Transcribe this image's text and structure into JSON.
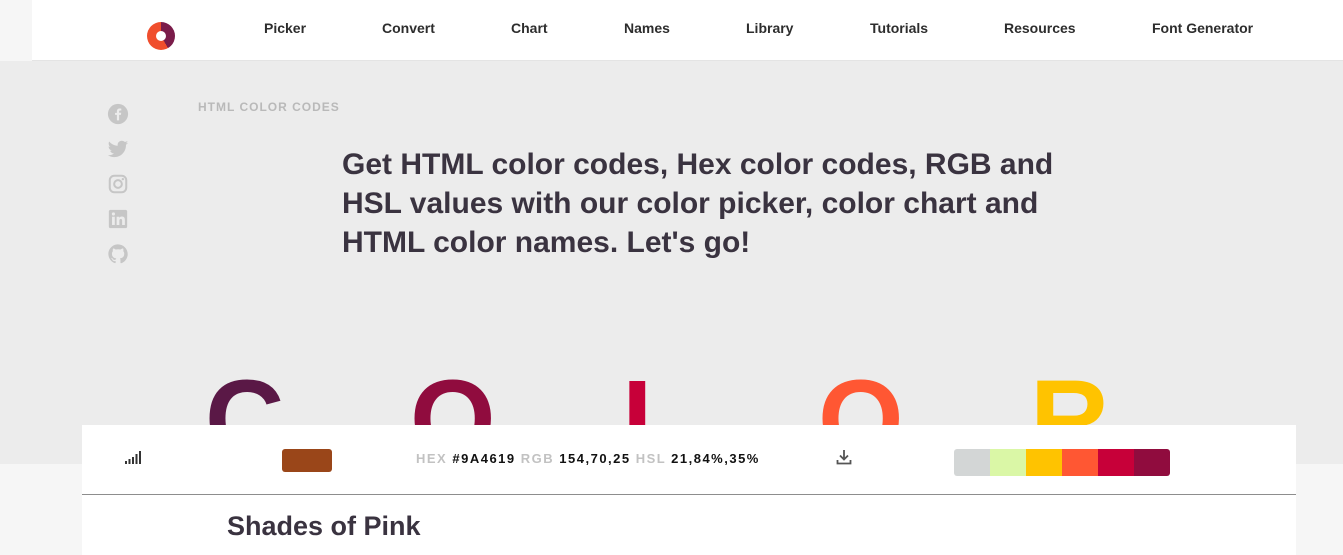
{
  "nav": {
    "items": [
      {
        "label": "Picker"
      },
      {
        "label": "Convert"
      },
      {
        "label": "Chart"
      },
      {
        "label": "Names"
      },
      {
        "label": "Library"
      },
      {
        "label": "Tutorials"
      },
      {
        "label": "Resources"
      },
      {
        "label": "Font Generator"
      }
    ]
  },
  "social": {
    "icons": [
      "facebook-icon",
      "twitter-icon",
      "instagram-icon",
      "linkedin-icon",
      "github-icon"
    ],
    "color": "#c6c6c6"
  },
  "hero": {
    "eyebrow": "HTML COLOR CODES",
    "headline": "Get HTML color codes, Hex color codes, RGB and HSL values with our color picker, color chart and HTML color names. Let's go!",
    "letters": [
      {
        "char": "C",
        "color": "#5a1846"
      },
      {
        "char": "O",
        "color": "#900c3e"
      },
      {
        "char": "L",
        "color": "#c70039"
      },
      {
        "char": "O",
        "color": "#ff5733"
      },
      {
        "char": "R",
        "color": "#ffc300"
      }
    ]
  },
  "toolbar": {
    "current_color": "#9A4619",
    "hex_label": "HEX",
    "hex_value": "#9A4619",
    "rgb_label": "RGB",
    "rgb_value": "154,70,25",
    "hsl_label": "HSL",
    "hsl_value": "21,84%,35%",
    "palette": [
      "#d3d6d6",
      "#daf7a6",
      "#ffc300",
      "#ff5733",
      "#c70039",
      "#900c3e"
    ]
  },
  "content": {
    "title": "Shades of Pink"
  }
}
